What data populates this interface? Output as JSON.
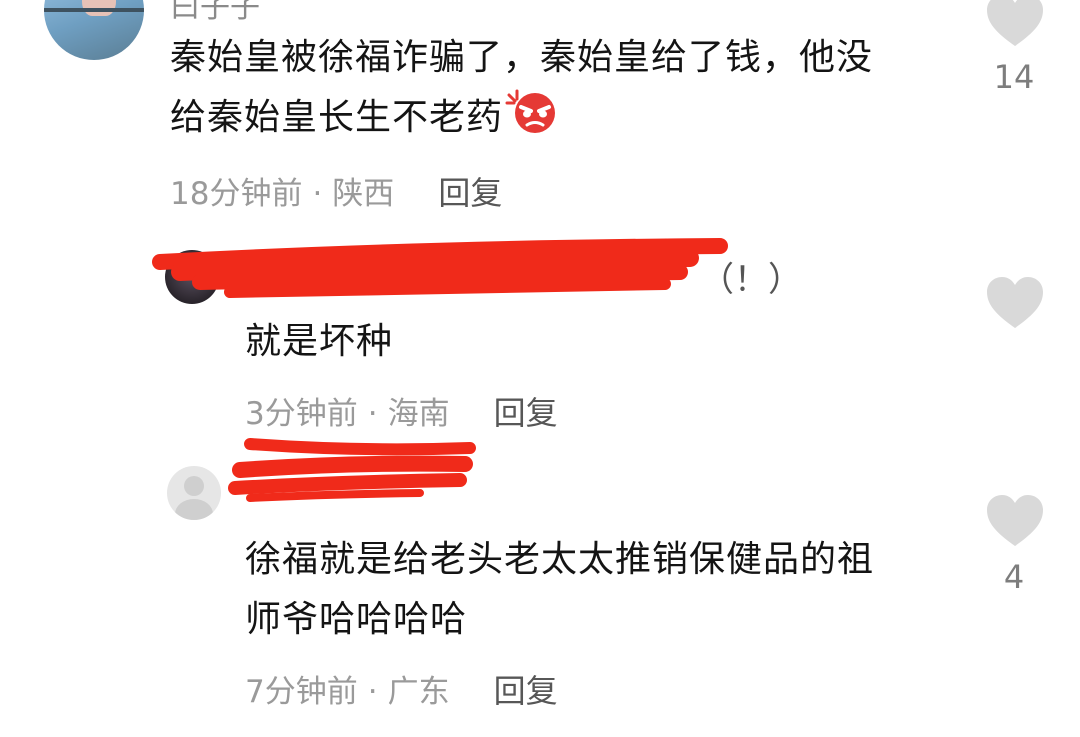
{
  "comments": [
    {
      "author": "曰子子",
      "text_line1": "秦始皇被徐福诈骗了，秦始皇给了钱，他没",
      "text_line2": "给秦始皇长生不老药",
      "emoji": "angry-face-icon",
      "time": "18分钟前",
      "location": "陕西",
      "reply_label": "回复",
      "likes": "14"
    },
    {
      "author_suffix": "（！）",
      "text": "就是坏种",
      "time": "3分钟前",
      "location": "海南",
      "reply_label": "回复"
    },
    {
      "text_line1": "徐福就是给老头老太太推销保健品的祖",
      "text_line2": "师爷哈哈哈哈",
      "time": "7分钟前",
      "location": "广东",
      "reply_label": "回复",
      "likes": "4"
    }
  ],
  "separator": "·",
  "colors": {
    "redaction": "#f02a1a",
    "heart": "#d9d9d9",
    "meta": "#9a9a9a"
  }
}
